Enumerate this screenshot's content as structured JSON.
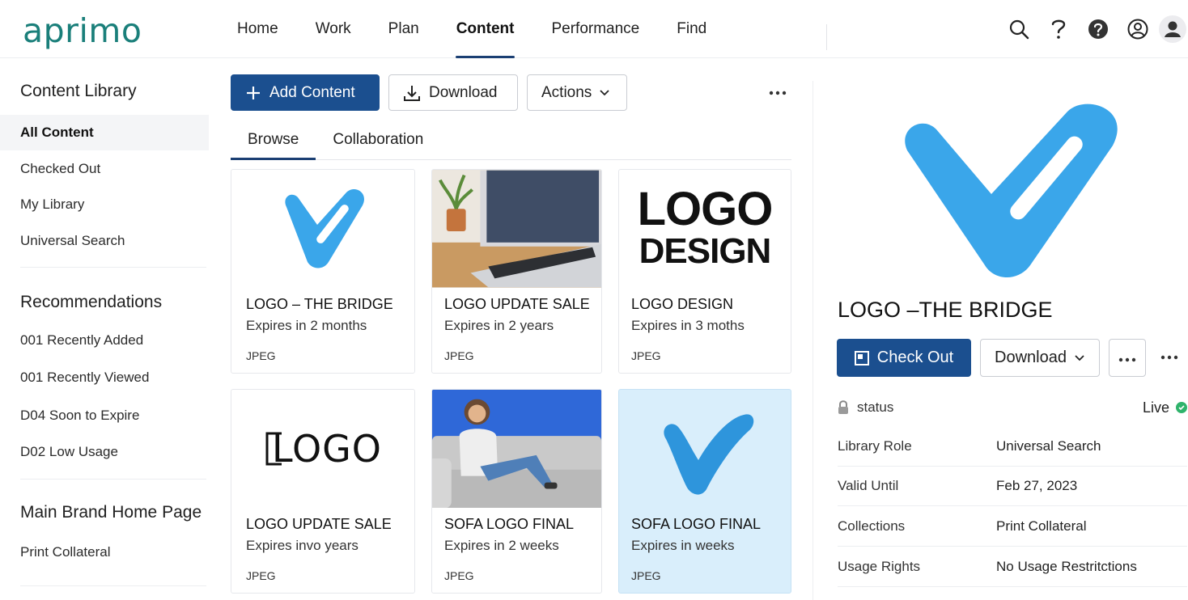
{
  "app": {
    "brand": "aprimo",
    "brand_color": "#1a7f7a",
    "accent_color": "#1b4f8f"
  },
  "nav": {
    "items": [
      {
        "label": "Home",
        "active": false
      },
      {
        "label": "Work",
        "active": false
      },
      {
        "label": "Plan",
        "active": false
      },
      {
        "label": "Content",
        "active": true
      },
      {
        "label": "Performance",
        "active": false
      },
      {
        "label": "Find",
        "active": false
      }
    ],
    "icons": [
      "search-icon",
      "help-icon",
      "help-circle-filled-icon",
      "user-circle-icon",
      "avatar-icon"
    ]
  },
  "sidebar": {
    "library_title": "Content Library",
    "library_items": [
      {
        "label": "All Content",
        "active": true
      },
      {
        "label": "Checked Out",
        "active": false
      },
      {
        "label": "My Library",
        "active": false
      },
      {
        "label": "Universal Search",
        "active": false
      }
    ],
    "recommendations_title": "Recommendations",
    "recommendation_items": [
      {
        "label": "001 Recently Added"
      },
      {
        "label": "001 Recently Viewed"
      },
      {
        "label": "D04 Soon to Expire"
      },
      {
        "label": "D02 Low Usage"
      }
    ],
    "brand_title": "Main Brand Home Page",
    "brand_items": [
      {
        "label": "Print Collateral"
      }
    ]
  },
  "toolbar": {
    "add_label": "Add Content",
    "download_label": "Download",
    "actions_label": "Actions"
  },
  "tabs": [
    {
      "label": "Browse",
      "active": true
    },
    {
      "label": "Collaboration",
      "active": false
    }
  ],
  "cards": [
    {
      "title": "LOGO – THE BRIDGE",
      "expiry": "Expires in 2 months",
      "type": "JPEG",
      "thumb": "blue-check-logo",
      "selected": false
    },
    {
      "title": "LOGO UPDATE SALE",
      "expiry": "Expires in 2 years",
      "type": "JPEG",
      "thumb": "laptop-photo",
      "selected": false
    },
    {
      "title": "LOGO DESIGN",
      "expiry": "Expires in 3 moths",
      "type": "JPEG",
      "thumb": "logo-design-text",
      "thumb_text": [
        "LOGO",
        "DESIGN"
      ],
      "selected": false
    },
    {
      "title": "LOGO UPDATE SALE",
      "expiry": "Expires invo years",
      "type": "JPEG",
      "thumb": "logo-outline-text",
      "thumb_text": [
        "LOGO"
      ],
      "selected": false
    },
    {
      "title": "SOFA LOGO FINAL",
      "expiry": "Expires in 2 weeks",
      "type": "JPEG",
      "thumb": "sofa-photo",
      "selected": false
    },
    {
      "title": "SOFA LOGO FINAL",
      "expiry": "Expires in weeks",
      "type": "JPEG",
      "thumb": "blue-check-swoosh",
      "selected": true
    }
  ],
  "panel": {
    "title": "LOGO –THE BRIDGE",
    "checkout_label": "Check Out",
    "download_label": "Download",
    "status_label": "status",
    "status_value": "Live",
    "status_color": "#2fb36b",
    "properties": [
      {
        "key": "Library Role",
        "value": "Universal Search"
      },
      {
        "key": "Valid Until",
        "value": "Feb 27, 2023"
      },
      {
        "key": "Collections",
        "value": "Print Collateral"
      },
      {
        "key": "Usage Rights",
        "value": "No Usage Restritctions"
      }
    ]
  }
}
